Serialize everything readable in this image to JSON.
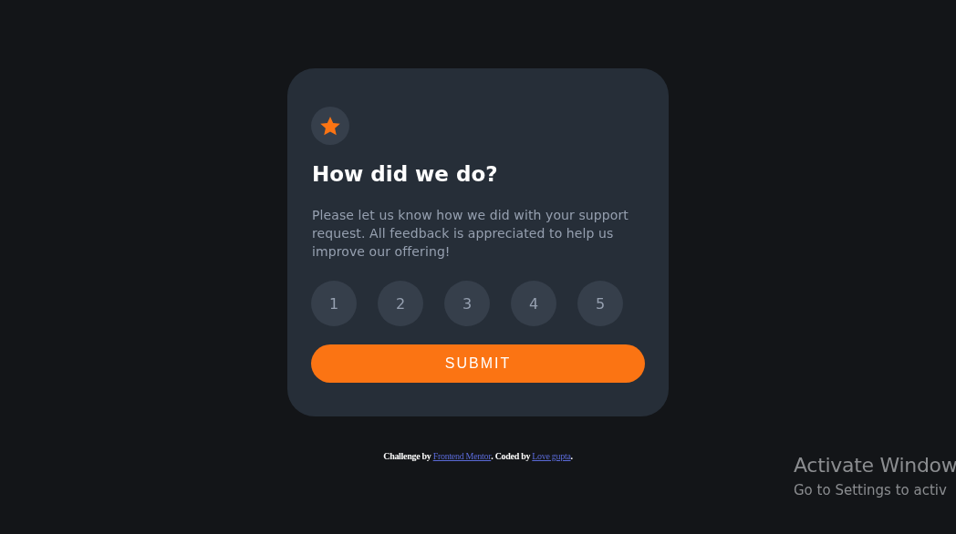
{
  "card": {
    "title": "How did we do?",
    "description": "Please let us know how we did with your support request. All feedback is appreciated to help us improve our offering!",
    "ratings": [
      {
        "label": "1",
        "selected": false
      },
      {
        "label": "2",
        "selected": false
      },
      {
        "label": "3",
        "selected": false
      },
      {
        "label": "4",
        "selected": false
      },
      {
        "label": "5",
        "selected": false
      }
    ],
    "submit": "SUBMIT"
  },
  "footer": {
    "parts": [
      {
        "kind": "text",
        "text": "Challenge by "
      },
      {
        "kind": "link",
        "text": "Frontend Mentor"
      },
      {
        "kind": "text",
        "text": ". Coded by "
      },
      {
        "kind": "link",
        "text": "Love gupta"
      },
      {
        "kind": "text",
        "text": "."
      }
    ]
  },
  "activation_notice": {
    "title": "Activate Window",
    "subtitle": "Go to Settings to activ"
  }
}
